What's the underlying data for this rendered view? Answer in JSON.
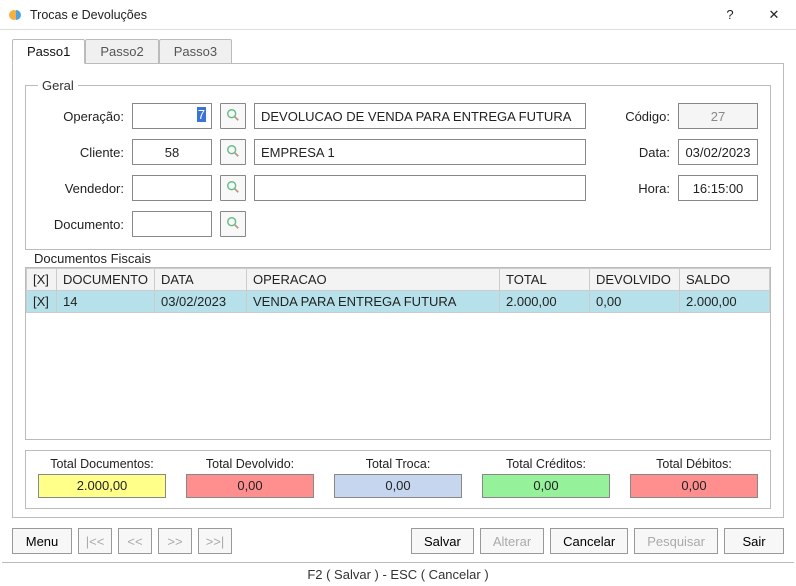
{
  "window": {
    "title": "Trocas e Devoluções",
    "help": "?",
    "close": "✕"
  },
  "tabs": [
    "Passo1",
    "Passo2",
    "Passo3"
  ],
  "active_tab": 0,
  "geral": {
    "legend": "Geral",
    "labels": {
      "operacao": "Operação:",
      "cliente": "Cliente:",
      "vendedor": "Vendedor:",
      "documento": "Documento:",
      "codigo": "Código:",
      "data": "Data:",
      "hora": "Hora:"
    },
    "values": {
      "operacao_cod": "7",
      "operacao_desc": "DEVOLUCAO DE VENDA PARA ENTREGA FUTURA",
      "cliente_cod": "58",
      "cliente_desc": "EMPRESA 1",
      "vendedor_cod": "",
      "vendedor_desc": "",
      "documento": "",
      "codigo": "27",
      "data": "03/02/2023",
      "hora": "16:15:00"
    }
  },
  "grid": {
    "legend": "Documentos Fiscais",
    "headers": [
      "[X]",
      "DOCUMENTO",
      "DATA",
      "OPERACAO",
      "TOTAL",
      "DEVOLVIDO",
      "SALDO"
    ],
    "rows": [
      {
        "sel": "[X]",
        "documento": "14",
        "data": "03/02/2023",
        "operacao": "VENDA PARA ENTREGA FUTURA",
        "total": "2.000,00",
        "devolvido": "0,00",
        "saldo": "2.000,00",
        "selected": true
      }
    ]
  },
  "totals": [
    {
      "label": "Total Documentos:",
      "value": "2.000,00",
      "colorClass": "yellow"
    },
    {
      "label": "Total Devolvido:",
      "value": "0,00",
      "colorClass": "red"
    },
    {
      "label": "Total Troca:",
      "value": "0,00",
      "colorClass": "blue"
    },
    {
      "label": "Total Créditos:",
      "value": "0,00",
      "colorClass": "green"
    },
    {
      "label": "Total Débitos:",
      "value": "0,00",
      "colorClass": "red"
    }
  ],
  "buttons": {
    "menu": "Menu",
    "first": "|<<",
    "prev": "<<",
    "next": ">>",
    "last": ">>|",
    "salvar": "Salvar",
    "alterar": "Alterar",
    "cancelar": "Cancelar",
    "pesquisar": "Pesquisar",
    "sair": "Sair"
  },
  "status": "F2 ( Salvar )  -  ESC ( Cancelar )"
}
